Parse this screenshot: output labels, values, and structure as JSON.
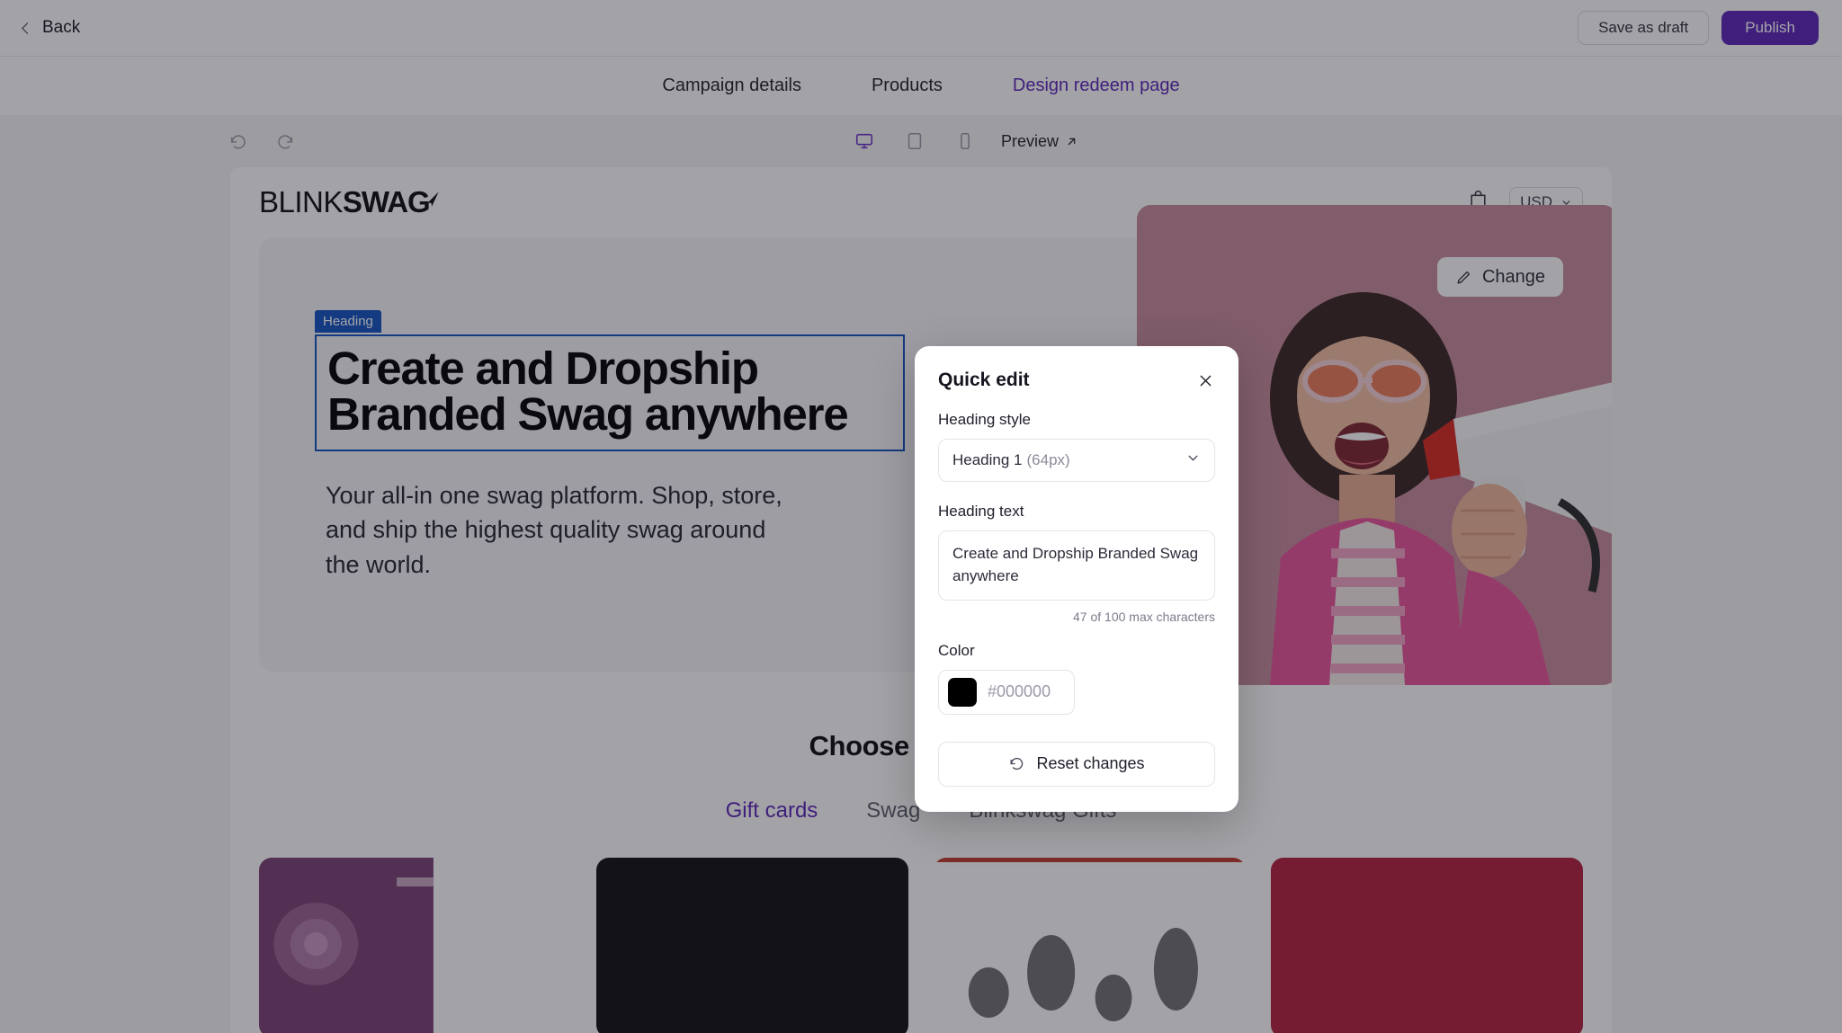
{
  "topbar": {
    "back_label": "Back",
    "save_draft_label": "Save as draft",
    "publish_label": "Publish"
  },
  "tabs": [
    {
      "label": "Campaign details",
      "active": false
    },
    {
      "label": "Products",
      "active": false
    },
    {
      "label": "Design redeem page",
      "active": true
    }
  ],
  "toolbar": {
    "undo_icon": "undo-icon",
    "redo_icon": "redo-icon",
    "devices": [
      {
        "name": "desktop",
        "active": true
      },
      {
        "name": "tablet",
        "active": false
      },
      {
        "name": "mobile",
        "active": false
      }
    ],
    "preview_label": "Preview"
  },
  "store": {
    "logo_light": "BLINK",
    "logo_bold": "SWAG",
    "cart_icon": "shopping-bag-icon",
    "currency": "USD"
  },
  "hero": {
    "badge_label": "Heading",
    "heading": "Create and Dropship Branded Swag anywhere",
    "heading_line1": "Create and Dropship",
    "heading_line2": "Branded Swag anywhere",
    "paragraph": "Your all-in one swag platform. Shop, store, and ship the highest quality swag around the world.",
    "quick_edit_label": "Quick edit",
    "change_label": "Change"
  },
  "products": {
    "title": "Choose products",
    "tabs": [
      {
        "label": "Gift cards",
        "active": true
      },
      {
        "label": "Swag",
        "active": false
      },
      {
        "label": "Blinkswag Gifts",
        "active": false
      }
    ],
    "cards": [
      {
        "name": "product-card-1",
        "color": "#6b3a6b"
      },
      {
        "name": "product-card-2",
        "color": "#121212"
      },
      {
        "name": "product-card-3",
        "color": "#c0392b"
      },
      {
        "name": "product-card-4",
        "color": "#b21e3e"
      }
    ]
  },
  "modal": {
    "title": "Quick edit",
    "close_icon": "close-icon",
    "heading_style_label": "Heading style",
    "heading_style_value": "Heading 1",
    "heading_style_size": "(64px)",
    "heading_text_label": "Heading text",
    "heading_text_value": "Create and Dropship Branded Swag anywhere",
    "char_count": "47 of 100 max characters",
    "color_label": "Color",
    "color_value": "#000000",
    "color_swatch": "#000000",
    "reset_label": "Reset changes"
  },
  "colors": {
    "accent_purple": "#5a23b8",
    "selection_blue": "#1151c0",
    "canvas_bg": "#f4f4f6"
  }
}
